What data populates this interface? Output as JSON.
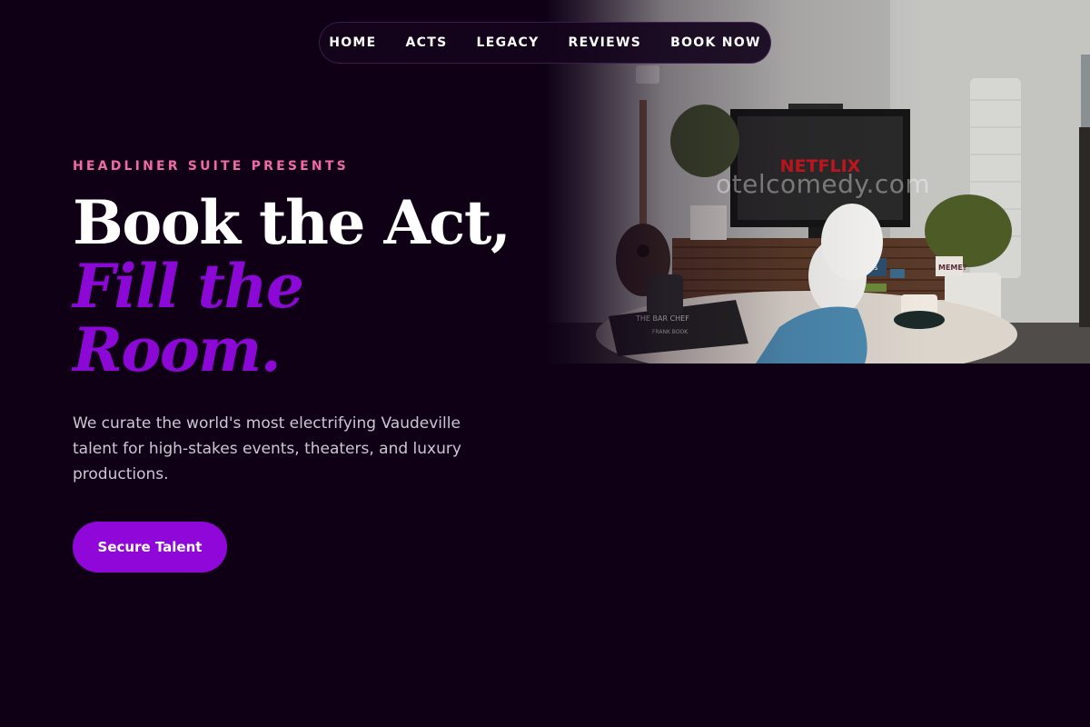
{
  "nav": {
    "items": [
      {
        "label": "HOME"
      },
      {
        "label": "ACTS"
      },
      {
        "label": "LEGACY"
      },
      {
        "label": "REVIEWS"
      },
      {
        "label": "BOOK NOW"
      }
    ]
  },
  "hero": {
    "eyebrow": "HEADLINER SUITE PRESENTS",
    "headline_line1": "Book the Act,",
    "headline_line2": "Fill the",
    "headline_line3": "Room.",
    "subtext": "We curate the world's most electrifying Vaudeville talent for high-stakes events, theaters, and luxury productions.",
    "cta_label": "Secure Talent"
  },
  "image": {
    "tv_brand": "NETFLIX",
    "book_title": "THE BAR CHEF",
    "book_subtitle": "FRANK BOOK",
    "sign_text": "MEME?",
    "dvd_text": "ations",
    "watermark": "otelcomedy.com"
  },
  "colors": {
    "background": "#0f0016",
    "accent_purple": "#8c08d6",
    "eyebrow_pink": "#f06aa3",
    "netflix_red": "#c8161d"
  }
}
